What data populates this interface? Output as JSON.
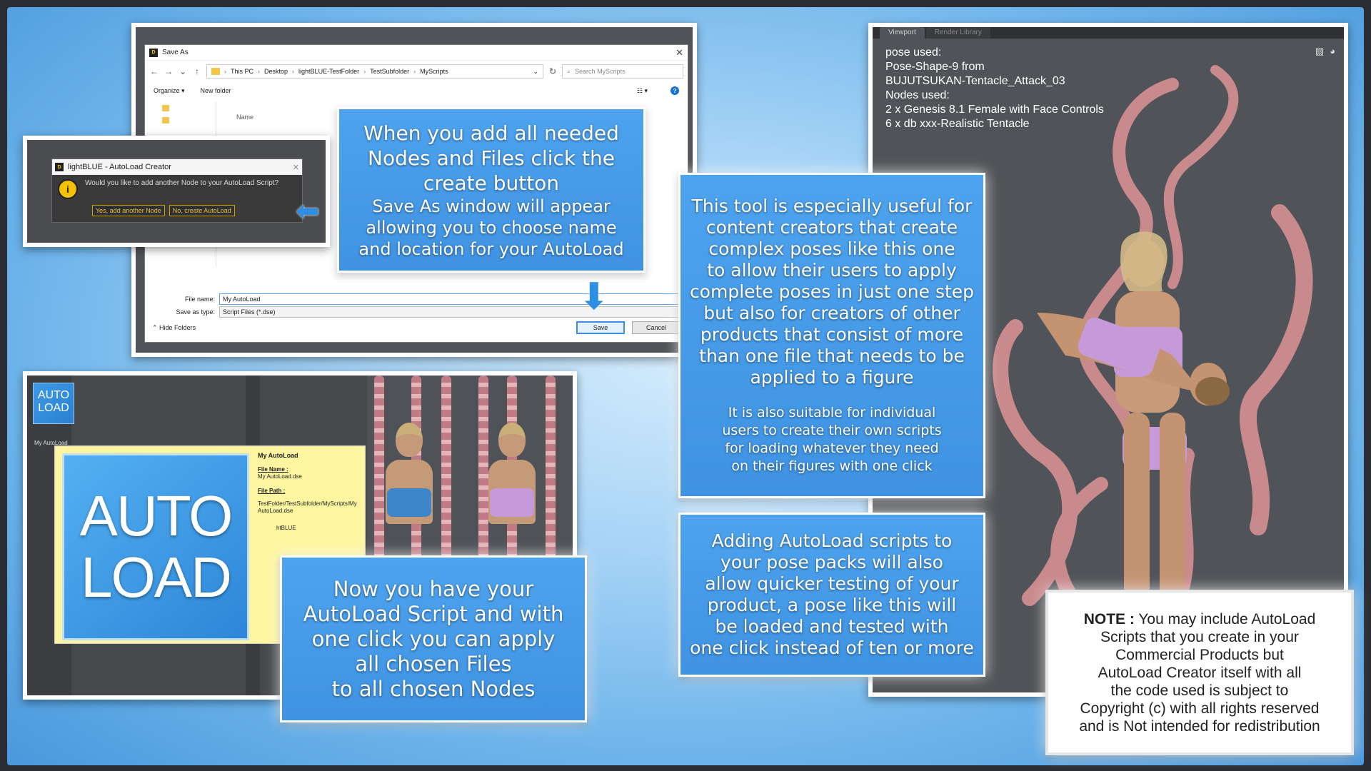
{
  "save_as": {
    "title": "Save As",
    "breadcrumbs": [
      "This PC",
      "Desktop",
      "lightBLUE-TestFolder",
      "TestSubfolder",
      "MyScripts"
    ],
    "search_placeholder": "Search MyScripts",
    "organize_label": "Organize ▾",
    "new_folder_label": "New folder",
    "column_name": "Name",
    "file_name_label": "File name:",
    "file_name_value": "My AutoLoad",
    "save_type_label": "Save as type:",
    "save_type_value": "Script Files (*.dse)",
    "hide_folders_label": "Hide Folders",
    "save_button": "Save",
    "cancel_button": "Cancel"
  },
  "dialog": {
    "title": "lightBLUE - AutoLoad Creator",
    "message": "Would you like to add another Node to your AutoLoad Script?",
    "yes_button": "Yes, add another Node",
    "no_button": "No, create AutoLoad"
  },
  "box_create": {
    "line1": "When you add all needed",
    "line2": "Nodes and Files click the",
    "line3": "create button",
    "line4": "Save As window will appear",
    "line5": "allowing you to choose name",
    "line6": "and location for your AutoLoad"
  },
  "box_tool": {
    "lines": [
      "This tool is especially useful for",
      "content creators that create",
      "complex poses like this one",
      "to allow their users to apply",
      "complete poses in just one step",
      "but also for creators of other",
      "products that consist of more",
      "than one file that needs to be",
      "applied to a figure"
    ],
    "sub_lines": [
      "It is also suitable for individual",
      "users to create their own scripts",
      "for loading whatever they need",
      "on their figures with one click"
    ]
  },
  "box_testing": {
    "lines": [
      "Adding AutoLoad scripts to",
      "your pose packs will also",
      "allow quicker testing of your",
      "product, a pose like this will",
      "be loaded and tested with",
      "one click instead of ten or more"
    ]
  },
  "box_now": {
    "lines": [
      "Now you have your",
      "AutoLoad Script and with",
      "one click you can apply",
      "all chosen Files",
      "to all chosen Nodes"
    ]
  },
  "box_note": {
    "label": "NOTE :",
    "lines": [
      " You may include AutoLoad",
      "Scripts that you create in your",
      "Commercial Products but",
      "AutoLoad Creator itself with all",
      "the code used is subject to",
      "Copyright (c) with all rights reserved",
      "and is Not intended for redistribution"
    ]
  },
  "script_panel": {
    "tile_small_text_1": "AUTO",
    "tile_small_text_2": "LOAD",
    "tile_small_label": "My AutoLoad",
    "big_tile_line1": "AUTO",
    "big_tile_line2": "LOAD",
    "card_title": "My AutoLoad",
    "file_name_heading": "File Name :",
    "file_name_value": "My AutoLoad.dse",
    "file_path_heading": "File Path :",
    "file_path_value": "TestFolder/TestSubfolder/MyScripts/My AutoLoad.dse",
    "author_partial": "htBLUE"
  },
  "viewport": {
    "tab_active": "Viewport",
    "tab_inactive": "Render Library",
    "info_lines": [
      "pose used:",
      "Pose-Shape-9 from",
      "BUJUTSUKAN-Tentacle_Attack_03",
      "Nodes used:",
      "2 x Genesis 8.1 Female with Face Controls",
      "6 x db xxx-Realistic Tentacle"
    ]
  },
  "colors": {
    "accent_blue": "#3f93e2",
    "arrow_blue": "#2d8ee6",
    "dialog_button_gold": "#e8c14a"
  }
}
